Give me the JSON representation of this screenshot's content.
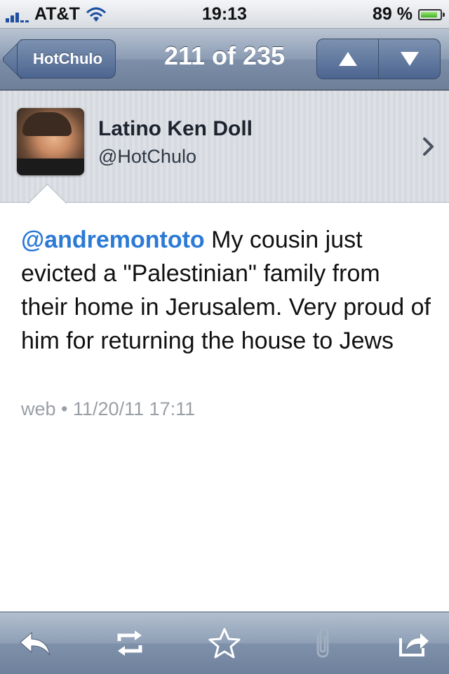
{
  "status_bar": {
    "carrier": "AT&T",
    "time": "19:13",
    "battery_percent": "89 %",
    "battery_level": 0.89
  },
  "nav": {
    "back_label": "HotChulo",
    "title": "211 of 235",
    "prev_icon": "up-arrow-icon",
    "next_icon": "down-arrow-icon"
  },
  "profile": {
    "name": "Latino Ken Doll",
    "handle": "@HotChulo"
  },
  "tweet": {
    "mention": "@andremontoto",
    "text": " My cousin just evicted a \"Palestinian\" family from their home in Jerusalem. Very proud of him for returning the house to Jews",
    "source": "web",
    "separator": "•",
    "timestamp": "11/20/11 17:11"
  },
  "toolbar": {
    "icons": [
      "reply-icon",
      "retweet-icon",
      "favorite-star-icon",
      "attachment-icon",
      "share-icon"
    ]
  },
  "colors": {
    "mention": "#2b7ad6",
    "nav_bar": "#7c8ea8",
    "meta_text": "#9a9fa6"
  }
}
